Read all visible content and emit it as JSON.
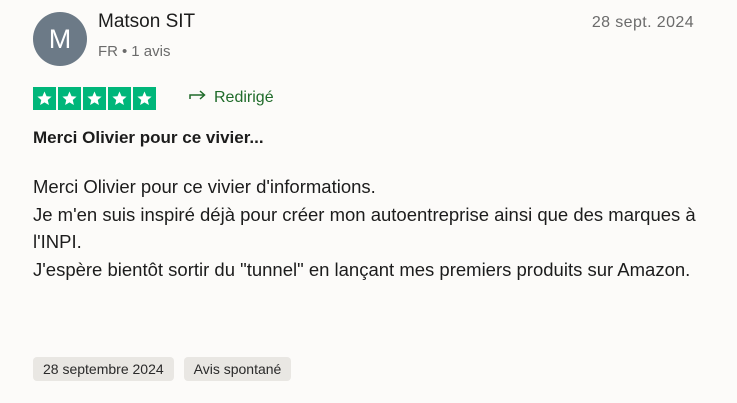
{
  "review": {
    "author": {
      "initial": "M",
      "name": "Matson SIT",
      "country": "FR",
      "separator": "•",
      "review_count": "1 avis",
      "avatar_color": "#6c7a87"
    },
    "date": "28 sept. 2024",
    "rating": 5,
    "star_color": "#00b67a",
    "edited_label": "Redirigé",
    "title": "Merci Olivier pour ce vivier...",
    "body_lines": [
      "Merci Olivier pour ce vivier d'informations.",
      "Je m'en suis inspiré déjà pour créer mon autoentreprise ainsi que des marques à l'INPI.",
      "J'espère bientôt sortir du \"tunnel\" en lançant mes premiers produits sur Amazon."
    ],
    "tags": {
      "experience_date": "28 septembre 2024",
      "review_type": "Avis spontané"
    },
    "icons": {
      "edited": "redirect-arrow-icon",
      "star": "star-icon"
    }
  }
}
